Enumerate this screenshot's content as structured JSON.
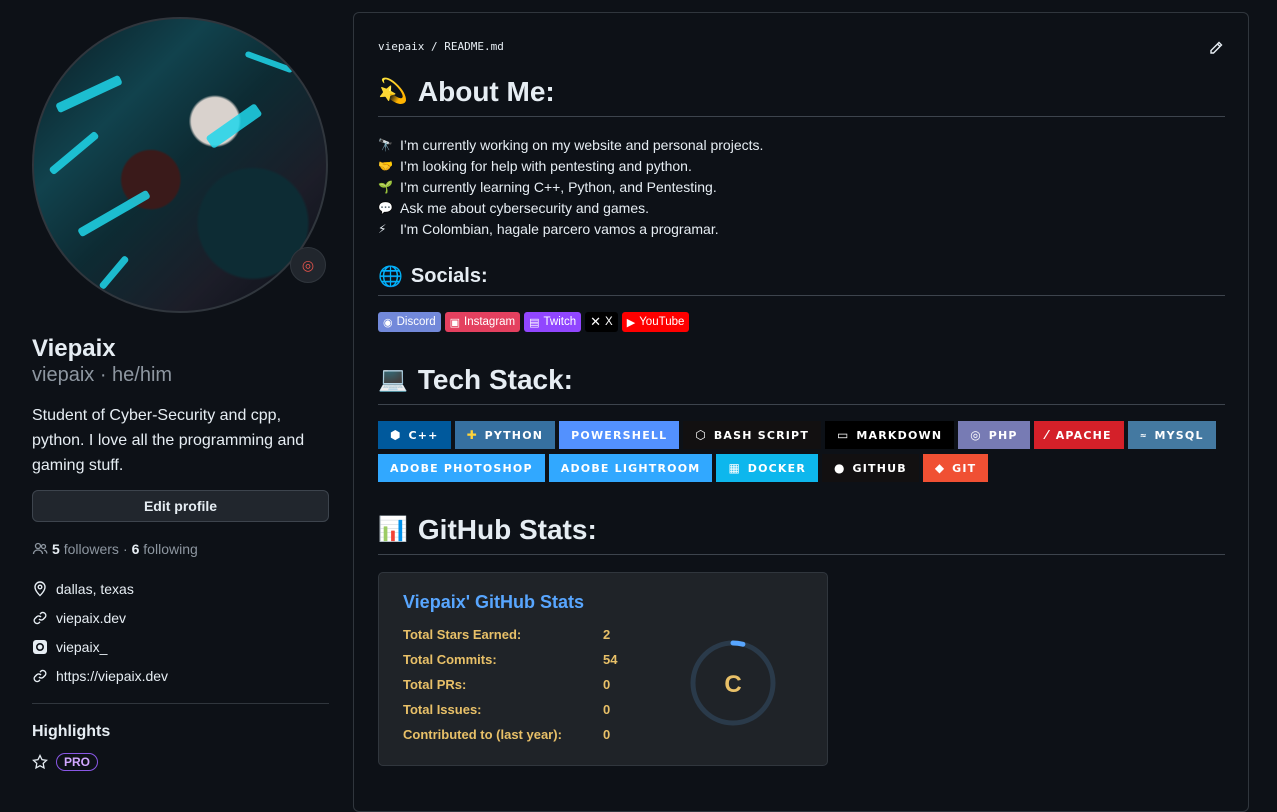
{
  "profile": {
    "name": "Viepaix",
    "login": "viepaix · he/him",
    "bio": "Student of Cyber-Security and cpp, python. I love all the programming and gaming stuff.",
    "edit_label": "Edit profile",
    "followers_count": "5",
    "followers_label": "followers",
    "separator": "·",
    "following_count": "6",
    "following_label": "following",
    "location": "dallas, texas",
    "website": "viepaix.dev",
    "instagram": "viepaix_",
    "link": "https://viepaix.dev",
    "highlights_title": "Highlights",
    "pro_badge": "PRO"
  },
  "readme": {
    "owner": "viepaix",
    "sep": "/",
    "file": "README.md",
    "about_title": "About Me:",
    "about_emoji": "💫",
    "about_items": [
      {
        "emoji": "🔭",
        "text": "I’m currently working on my website and personal projects."
      },
      {
        "emoji": "🤝",
        "text": "I’m looking for help with pentesting and python."
      },
      {
        "emoji": "🌱",
        "text": "I’m currently learning C++, Python, and Pentesting."
      },
      {
        "emoji": "💬",
        "text": "Ask me about cybersecurity and games."
      },
      {
        "emoji": "⚡",
        "text": "I'm Colombian, hagale parcero vamos a programar."
      }
    ],
    "socials_title": "Socials:",
    "socials_emoji": "🌐",
    "socials": [
      {
        "label": "Discord",
        "color": "#7289da"
      },
      {
        "label": "Instagram",
        "color": "#e4405f"
      },
      {
        "label": "Twitch",
        "color": "#9146ff"
      },
      {
        "label": "X",
        "color": "#000000"
      },
      {
        "label": "YouTube",
        "color": "#ff0000"
      }
    ],
    "tech_title": "Tech Stack:",
    "tech_emoji": "💻",
    "tech_row1": [
      {
        "label": "C++",
        "color": "#00599c"
      },
      {
        "label": "Python",
        "color": "#3670a0"
      },
      {
        "label": "PowerShell",
        "color": "#5391fe"
      },
      {
        "label": "Bash Script",
        "color": "#121011"
      },
      {
        "label": "Markdown",
        "color": "#000000"
      },
      {
        "label": "PHP",
        "color": "#777bb4"
      },
      {
        "label": "Apache",
        "color": "#d42029"
      },
      {
        "label": "MySQL",
        "color": "#4479a1"
      }
    ],
    "tech_row2": [
      {
        "label": "Adobe Photoshop",
        "color": "#31a8ff"
      },
      {
        "label": "Adobe Lightroom",
        "color": "#31a8ff"
      },
      {
        "label": "Docker",
        "color": "#0db7ed"
      },
      {
        "label": "GitHub",
        "color": "#121011"
      },
      {
        "label": "Git",
        "color": "#f05033"
      }
    ],
    "stats_title_section": "GitHub Stats:",
    "stats_emoji": "📊",
    "stats_card_title": "Viepaix' GitHub Stats",
    "stats": [
      {
        "label": "Total Stars Earned:",
        "value": "2"
      },
      {
        "label": "Total Commits:",
        "value": "54"
      },
      {
        "label": "Total PRs:",
        "value": "0"
      },
      {
        "label": "Total Issues:",
        "value": "0"
      },
      {
        "label": "Contributed to (last year):",
        "value": "0"
      }
    ],
    "rank": "C",
    "rank_progress": 0.04
  }
}
